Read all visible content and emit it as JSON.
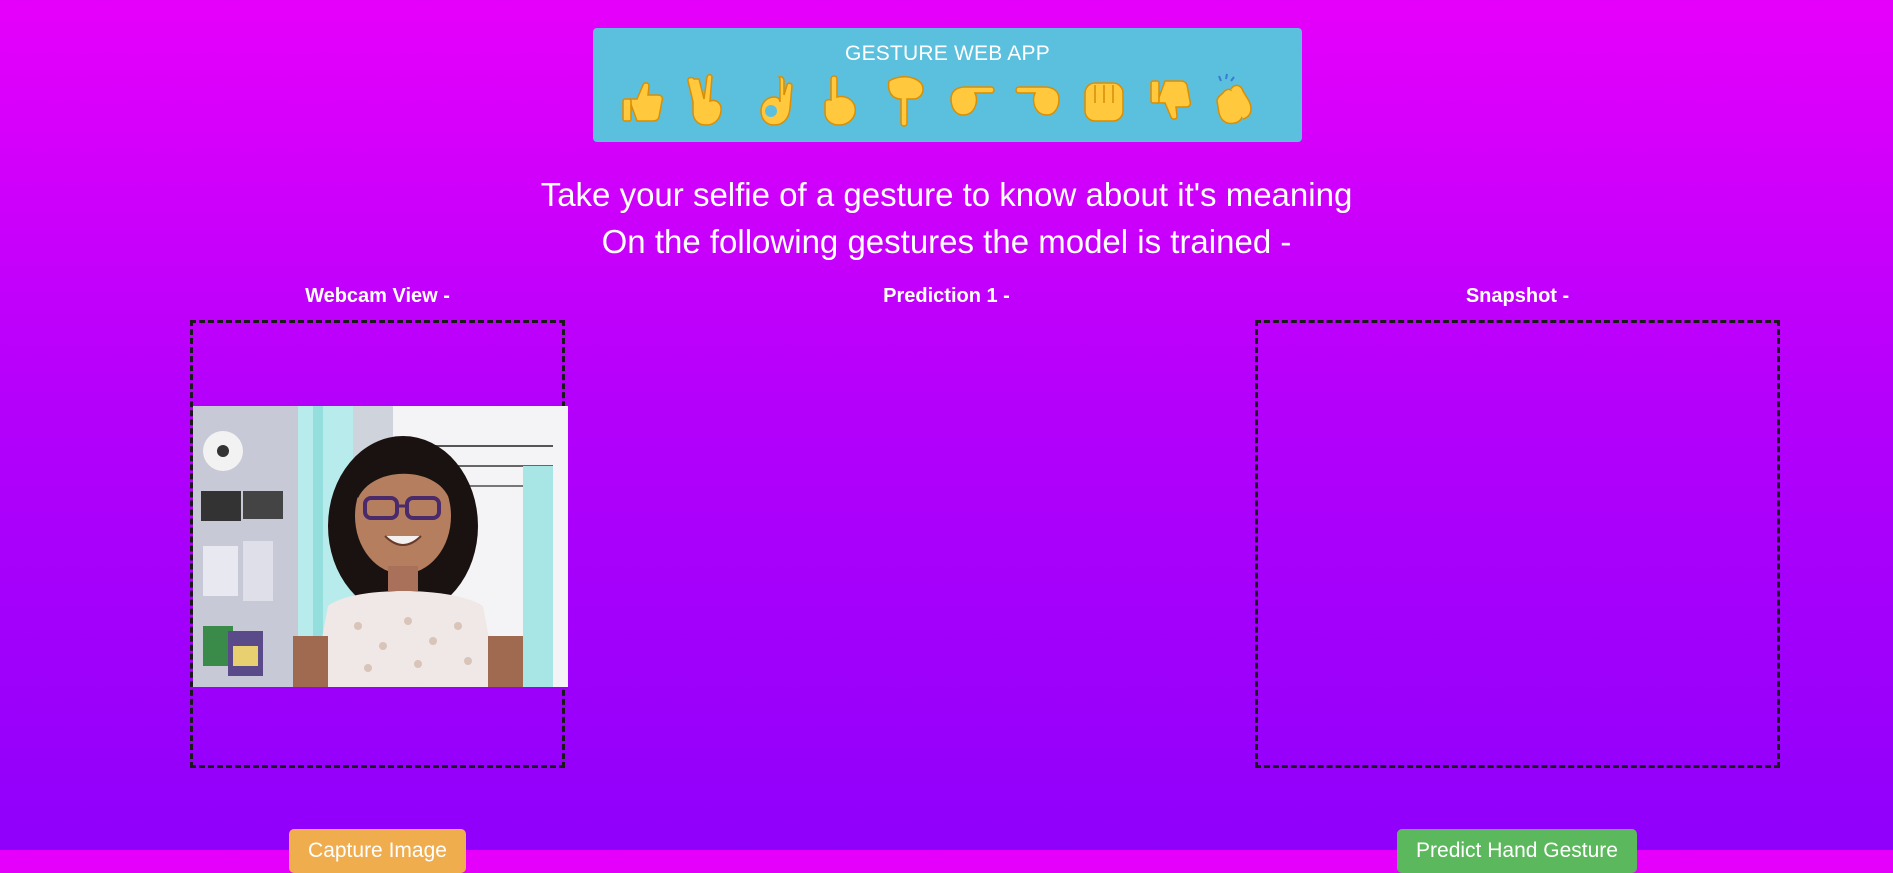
{
  "header": {
    "title": "GESTURE WEB APP",
    "gestures": [
      {
        "icon": "thumbs-up-icon"
      },
      {
        "icon": "victory-hand-icon"
      },
      {
        "icon": "ok-hand-icon"
      },
      {
        "icon": "point-up-icon"
      },
      {
        "icon": "point-down-icon"
      },
      {
        "icon": "point-right-icon"
      },
      {
        "icon": "point-left-icon"
      },
      {
        "icon": "fist-icon"
      },
      {
        "icon": "thumbs-down-icon"
      },
      {
        "icon": "clapping-hands-icon"
      }
    ]
  },
  "intro": {
    "line1": "Take your selfie of a gesture to know about it's meaning",
    "line2": "On the following gestures the model is trained -"
  },
  "panels": {
    "webcam_label": "Webcam View -",
    "prediction_label": "Prediction 1 -",
    "snapshot_label": "Snapshot -"
  },
  "buttons": {
    "capture_label": "Capture Image",
    "predict_label": "Predict Hand Gesture"
  },
  "colors": {
    "background_top": "#e600fb",
    "background_bottom": "#8f00fb",
    "header_bg": "#5bc0de",
    "emoji": "#ffc83d",
    "capture_button": "#f0ad4e",
    "predict_button": "#5cb85c"
  }
}
